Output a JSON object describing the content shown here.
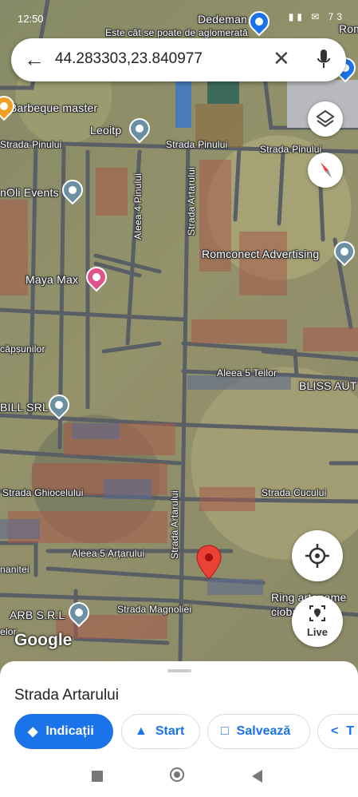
{
  "status_bar": {
    "time": "12:50",
    "icons": "▮▮ ✉ 73"
  },
  "search": {
    "query": "44.283303,23.840977"
  },
  "map": {
    "top_banner": "Este cât se poate de aglomerată",
    "pois": {
      "dedeman": "Dedeman",
      "rom": "Rom",
      "barbeque": "Barbeque master",
      "leoitp": "Leoitp",
      "events": "nOli Events",
      "romconect": "Romconect Advertising",
      "mayamax": "Maya Max",
      "bliss": "BLISS AUT",
      "bill": "BILL SRL",
      "ring": "Ring artoname",
      "ring2": "ciobal",
      "arb": "ARB S.R.L"
    },
    "streets": {
      "pinului_left": "Strada Pinului",
      "pinului_mid": "Strada Pinului",
      "pinului_right": "Strada Pinului",
      "aleea4": "Aleea 4 Pinului",
      "artarului_top": "Strada Artarului",
      "capsunilor": "căpșunilor",
      "aleea5teilor": "Aleea 5 Teilor",
      "ghiocelului": "Strada Ghiocelului",
      "cucului": "Strada Cucului",
      "artarului_bottom": "Strada Artarului",
      "aleea5artarului": "Aleea 5 Arțarului",
      "magnoliei": "Strada Magnoliei",
      "manitei": "nanitei",
      "elor": "elor"
    },
    "google_logo": "Google",
    "live_label": "Live"
  },
  "sheet": {
    "place_title": "Strada Artarului",
    "buttons": {
      "directions": "Indicații",
      "start": "Start",
      "save": "Salvează",
      "share": "T"
    }
  },
  "colors": {
    "accent": "#1a73e8",
    "pin_red": "#ea4335",
    "poi_gray": "#6b8fa3",
    "poi_pink": "#e0528a"
  }
}
